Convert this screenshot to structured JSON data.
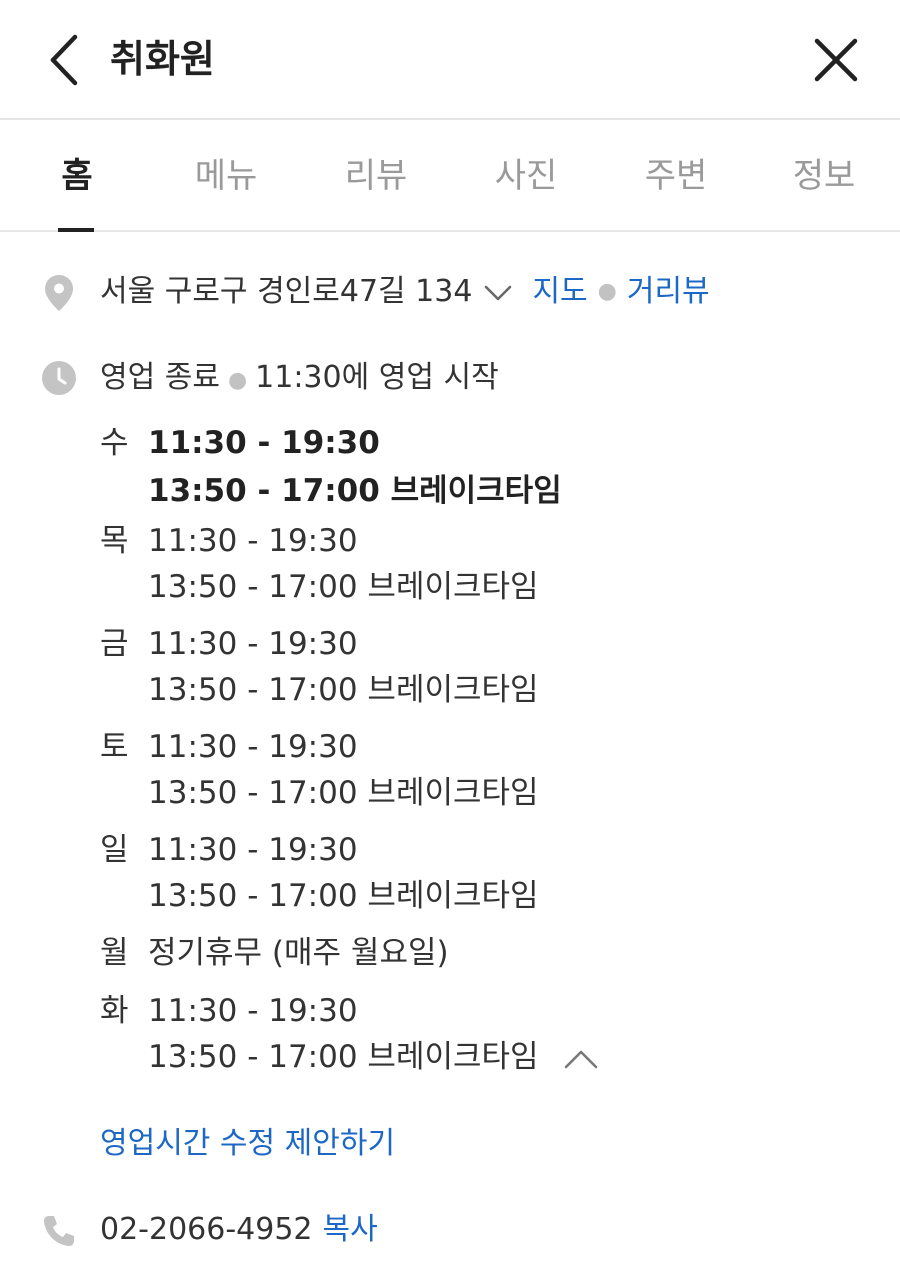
{
  "header": {
    "title": "취화원",
    "back_icon": "chevron-left-icon",
    "close_icon": "close-icon"
  },
  "tabs": [
    {
      "label": "홈",
      "active": true
    },
    {
      "label": "메뉴",
      "active": false
    },
    {
      "label": "리뷰",
      "active": false
    },
    {
      "label": "사진",
      "active": false
    },
    {
      "label": "주변",
      "active": false
    },
    {
      "label": "정보",
      "active": false
    }
  ],
  "address": {
    "text": "서울 구로구 경인로47길 134",
    "map_link": "지도",
    "street_view_link": "거리뷰",
    "icon": "location-pin-icon"
  },
  "business_status": {
    "status": "영업 종료",
    "next_open": "11:30에 영업 시작",
    "icon": "clock-icon"
  },
  "hours": [
    {
      "day": "수",
      "hours": "11:30 - 19:30",
      "break": "13:50 - 17:00 브레이크타임",
      "today": true
    },
    {
      "day": "목",
      "hours": "11:30 - 19:30",
      "break": "13:50 - 17:00 브레이크타임",
      "today": false
    },
    {
      "day": "금",
      "hours": "11:30 - 19:30",
      "break": "13:50 - 17:00 브레이크타임",
      "today": false
    },
    {
      "day": "토",
      "hours": "11:30 - 19:30",
      "break": "13:50 - 17:00 브레이크타임",
      "today": false
    },
    {
      "day": "일",
      "hours": "11:30 - 19:30",
      "break": "13:50 - 17:00 브레이크타임",
      "today": false
    },
    {
      "day": "월",
      "hours": "정기휴무 (매주 월요일)",
      "break": "",
      "today": false
    },
    {
      "day": "화",
      "hours": "11:30 - 19:30",
      "break": "13:50 - 17:00 브레이크타임",
      "today": false
    }
  ],
  "suggest_edit": "영업시간 수정 제안하기",
  "phone": {
    "number": "02-2066-4952",
    "copy_label": "복사",
    "icon": "phone-icon"
  },
  "colors": {
    "link": "#1d68c6",
    "text": "#333333",
    "muted": "#9a9a9a",
    "icon_gray": "#c4c4c4"
  }
}
